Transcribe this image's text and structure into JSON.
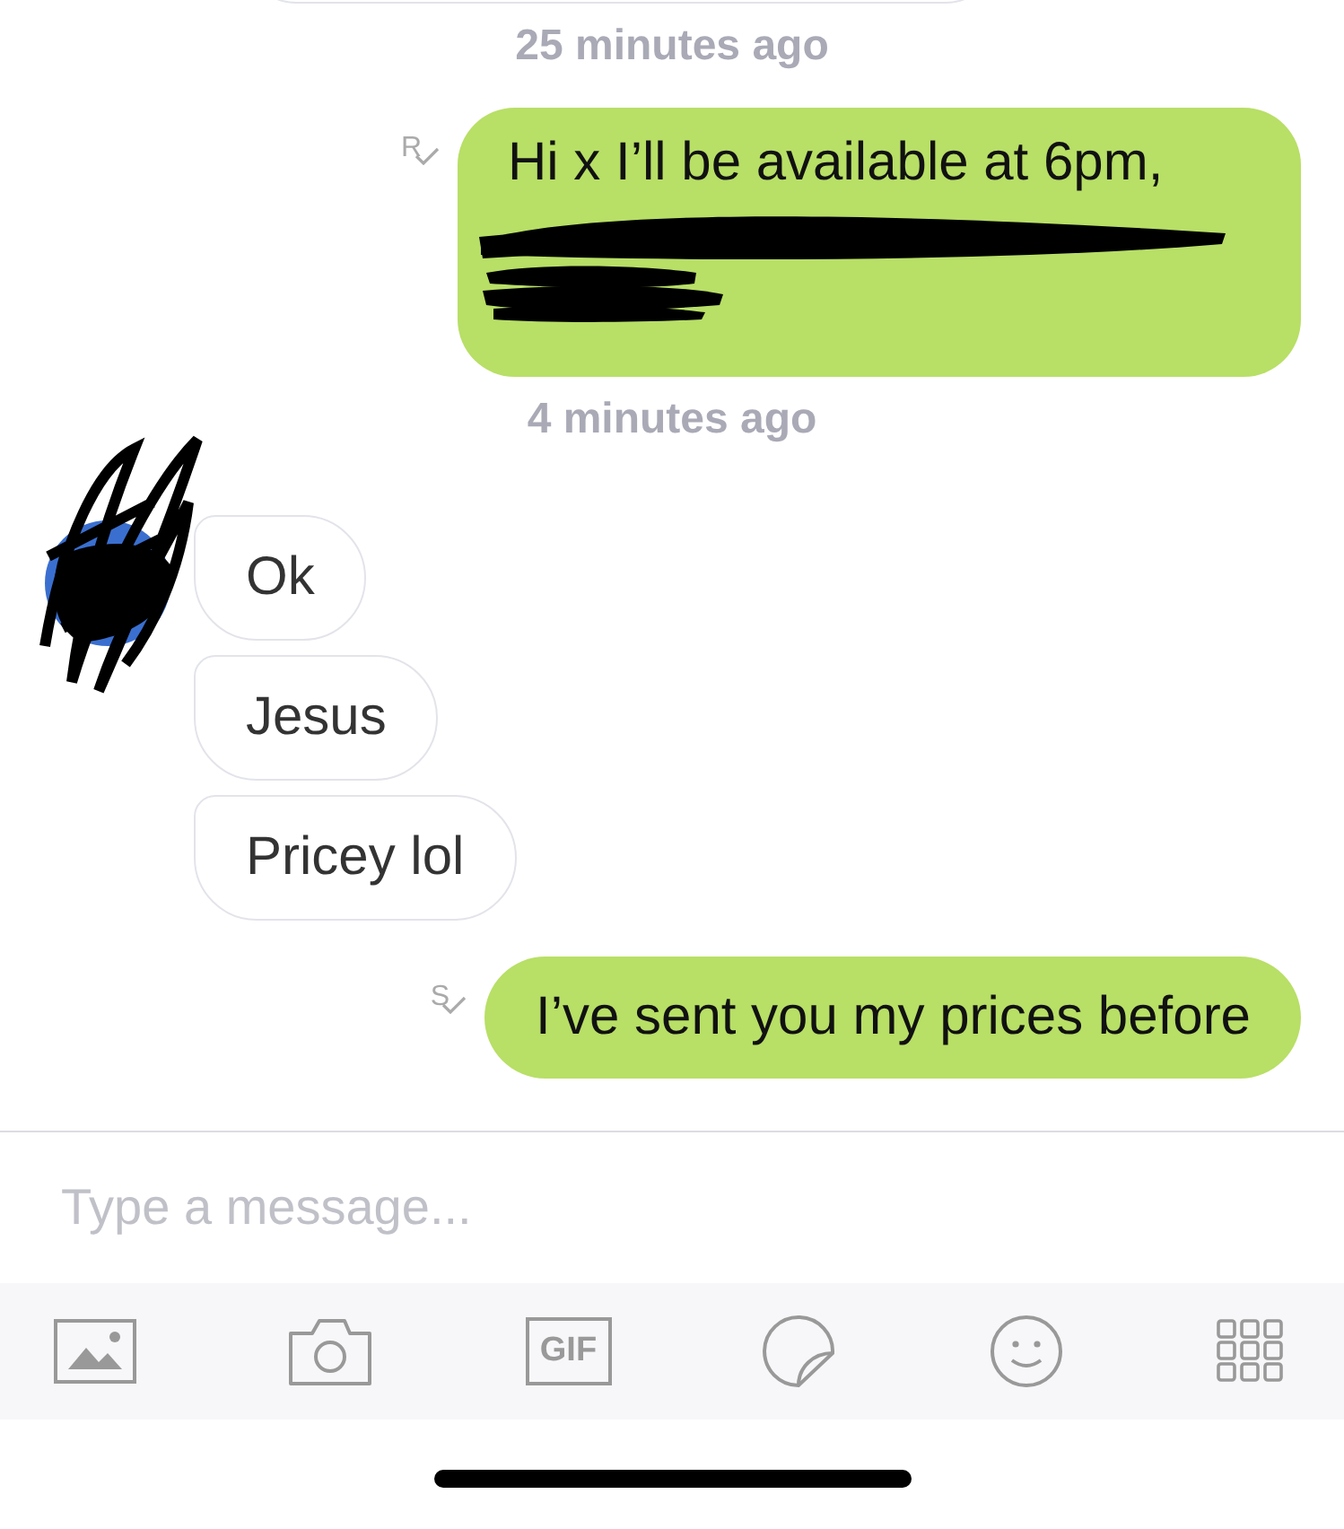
{
  "messages": [
    {
      "kind": "timestamp",
      "text": "25 minutes ago"
    },
    {
      "kind": "outgoing",
      "status": "R",
      "text": "Hi x I’ll be available at 6pm,",
      "redacted": true
    },
    {
      "kind": "timestamp",
      "text": "4 minutes ago"
    },
    {
      "kind": "incoming_group",
      "bubbles": [
        "Ok",
        "Jesus",
        "Pricey lol"
      ]
    },
    {
      "kind": "outgoing",
      "status": "S",
      "text": "I’ve sent you my prices before",
      "redacted": false
    }
  ],
  "composer": {
    "placeholder": "Type a message..."
  },
  "toolbar": [
    {
      "kind": "image"
    },
    {
      "kind": "camera"
    },
    {
      "kind": "gif",
      "label": "GIF"
    },
    {
      "kind": "sticker"
    },
    {
      "kind": "emoji"
    },
    {
      "kind": "grid"
    }
  ]
}
